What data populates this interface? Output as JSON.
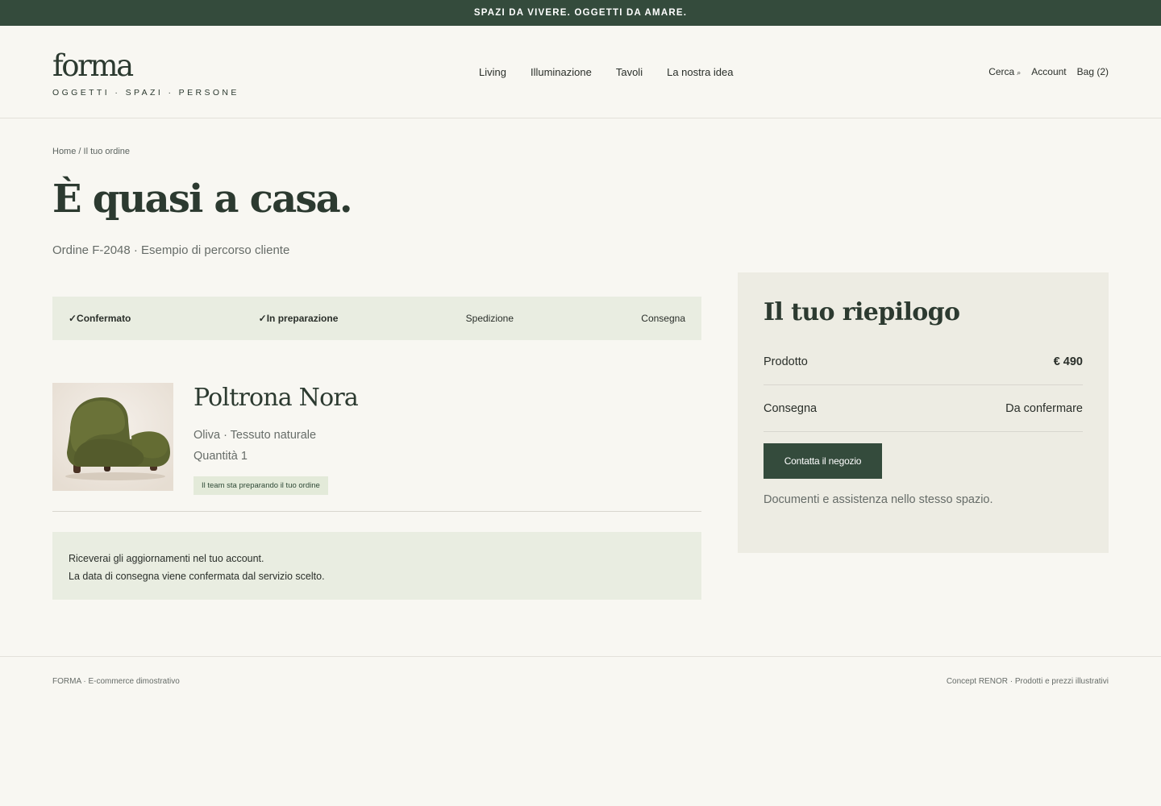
{
  "announcement": "SPAZI DA VIVERE. OGGETTI DA AMARE.",
  "brand": {
    "name": "forma",
    "tagline": "OGGETTI · SPAZI · PERSONE"
  },
  "nav": [
    "Living",
    "Illuminazione",
    "Tavoli",
    "La nostra idea"
  ],
  "utility": {
    "search": "Cerca",
    "search_icon": "search-icon",
    "account": "Account",
    "bag": "Bag (2)"
  },
  "breadcrumb": "Home / Il tuo ordine",
  "page_title": "È quasi a casa.",
  "subtitle": "Ordine F-2048 · Esempio di percorso cliente",
  "steps": [
    {
      "label": "✓Confermato",
      "state": "done"
    },
    {
      "label": "✓In preparazione",
      "state": "done"
    },
    {
      "label": "Spedizione",
      "state": "pending"
    },
    {
      "label": "Consegna",
      "state": "pending"
    }
  ],
  "product": {
    "name": "Poltrona Nora",
    "variant": "Oliva · Tessuto naturale",
    "quantity": "Quantità 1",
    "status": "Il team sta preparando il tuo ordine",
    "image_icon": "armchair-image"
  },
  "notice": {
    "line1": "Riceverai gli aggiornamenti nel tuo account.",
    "line2": "La data di consegna viene confermata dal servizio scelto."
  },
  "summary": {
    "title": "Il tuo riepilogo",
    "rows": [
      {
        "label": "Prodotto",
        "value": "€ 490"
      },
      {
        "label": "Consegna",
        "value": "Da confermare"
      }
    ],
    "cta": "Contatta il negozio",
    "note": "Documenti e assistenza nello stesso spazio."
  },
  "footer": {
    "left": "FORMA · E-commerce dimostrativo",
    "right": "Concept RENOR · Prodotti e prezzi illustrativi"
  },
  "colors": {
    "accent": "#344b3c",
    "background": "#f8f7f2",
    "soft_green": "#e9ede1",
    "panel": "#edece3"
  }
}
